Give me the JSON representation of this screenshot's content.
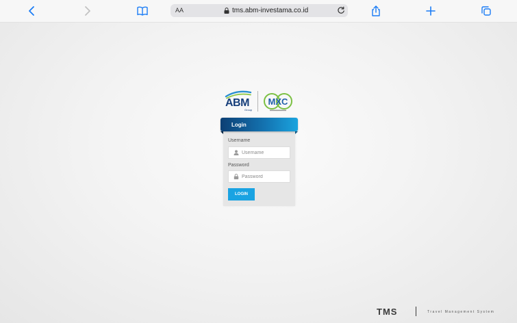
{
  "browser": {
    "text_size_label": "AA",
    "url": "tms.abm-investama.co.id"
  },
  "logos": {
    "abm_name": "ABM",
    "abm_group": "Group",
    "mxc_name": "MXC"
  },
  "login": {
    "header": "Login",
    "username_label": "Username",
    "username_placeholder": "Username",
    "password_label": "Password",
    "password_placeholder": "Password",
    "button_label": "LOGIN"
  },
  "footer": {
    "brand": "TMS",
    "tagline": "Travel Management System"
  },
  "colors": {
    "ios_blue": "#1a7cf5",
    "header_dark": "#0d3f74",
    "header_light": "#1ba4de",
    "button": "#1aa3e2"
  }
}
